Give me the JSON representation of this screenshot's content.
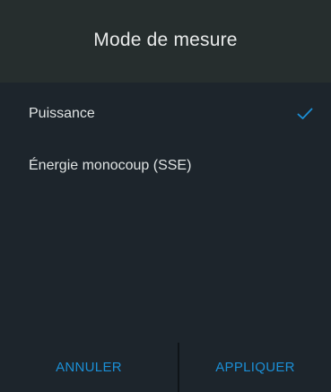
{
  "dialog": {
    "title": "Mode de mesure",
    "options": [
      {
        "label": "Puissance",
        "selected": true
      },
      {
        "label": "Énergie monocoup (SSE)",
        "selected": false
      }
    ],
    "buttons": {
      "cancel_label": "ANNULER",
      "apply_label": "APPLIQUER"
    },
    "colors": {
      "accent": "#1b8fd6",
      "header_background": "#262e2e",
      "body_background": "#1d252c"
    }
  }
}
